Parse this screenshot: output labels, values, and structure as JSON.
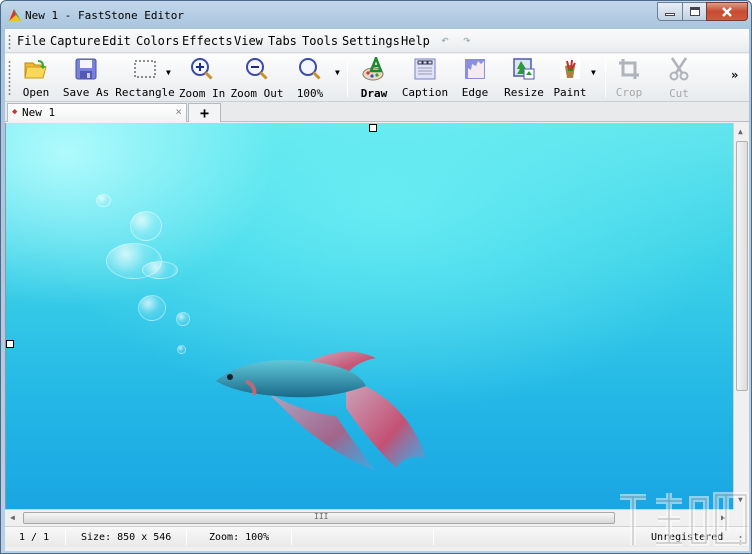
{
  "window": {
    "title": "New 1 - FastStone Editor",
    "controls": {
      "minimize": "minimize",
      "maximize": "maximize",
      "close": "close"
    }
  },
  "menubar": {
    "items": [
      "File",
      "Capture",
      "Edit",
      "Colors",
      "Effects",
      "View",
      "Tabs",
      "Tools",
      "Settings",
      "Help"
    ],
    "undo_icon": "undo-icon",
    "redo_icon": "redo-icon"
  },
  "toolbar": {
    "buttons": [
      {
        "label": "Open",
        "icon": "open-folder-icon",
        "enabled": true
      },
      {
        "label": "Save As",
        "icon": "floppy-disk-icon",
        "enabled": true
      },
      {
        "label": "Rectangle",
        "icon": "rectangle-select-icon",
        "enabled": true,
        "has_dropdown": true
      },
      {
        "label": "Zoom In",
        "icon": "zoom-in-icon",
        "enabled": true
      },
      {
        "label": "Zoom Out",
        "icon": "zoom-out-icon",
        "enabled": true
      },
      {
        "label": "100%",
        "icon": "zoom-actual-icon",
        "enabled": true,
        "has_dropdown": true
      },
      {
        "label": "Draw",
        "icon": "draw-palette-icon",
        "enabled": true,
        "bold": true
      },
      {
        "label": "Caption",
        "icon": "caption-icon",
        "enabled": true
      },
      {
        "label": "Edge",
        "icon": "edge-icon",
        "enabled": true
      },
      {
        "label": "Resize",
        "icon": "resize-icon",
        "enabled": true
      },
      {
        "label": "Paint",
        "icon": "paint-icon",
        "enabled": true,
        "has_dropdown": true
      },
      {
        "label": "Crop",
        "icon": "crop-icon",
        "enabled": false
      },
      {
        "label": "Cut",
        "icon": "scissors-icon",
        "enabled": false
      }
    ],
    "overflow": "»"
  },
  "tabs": {
    "items": [
      {
        "label": "New 1",
        "active": true
      }
    ],
    "close_glyph": "×",
    "add_glyph": "+"
  },
  "status": {
    "page": "1 / 1",
    "size": "Size: 850 x 546",
    "zoom": "Zoom: 100%",
    "registration": "Unregistered"
  },
  "scrollbar": {
    "grip": "III"
  },
  "colors": {
    "accent_close": "#c74a32",
    "canvas_top": "#62e6ee",
    "canvas_bottom": "#1aa6e2"
  }
}
